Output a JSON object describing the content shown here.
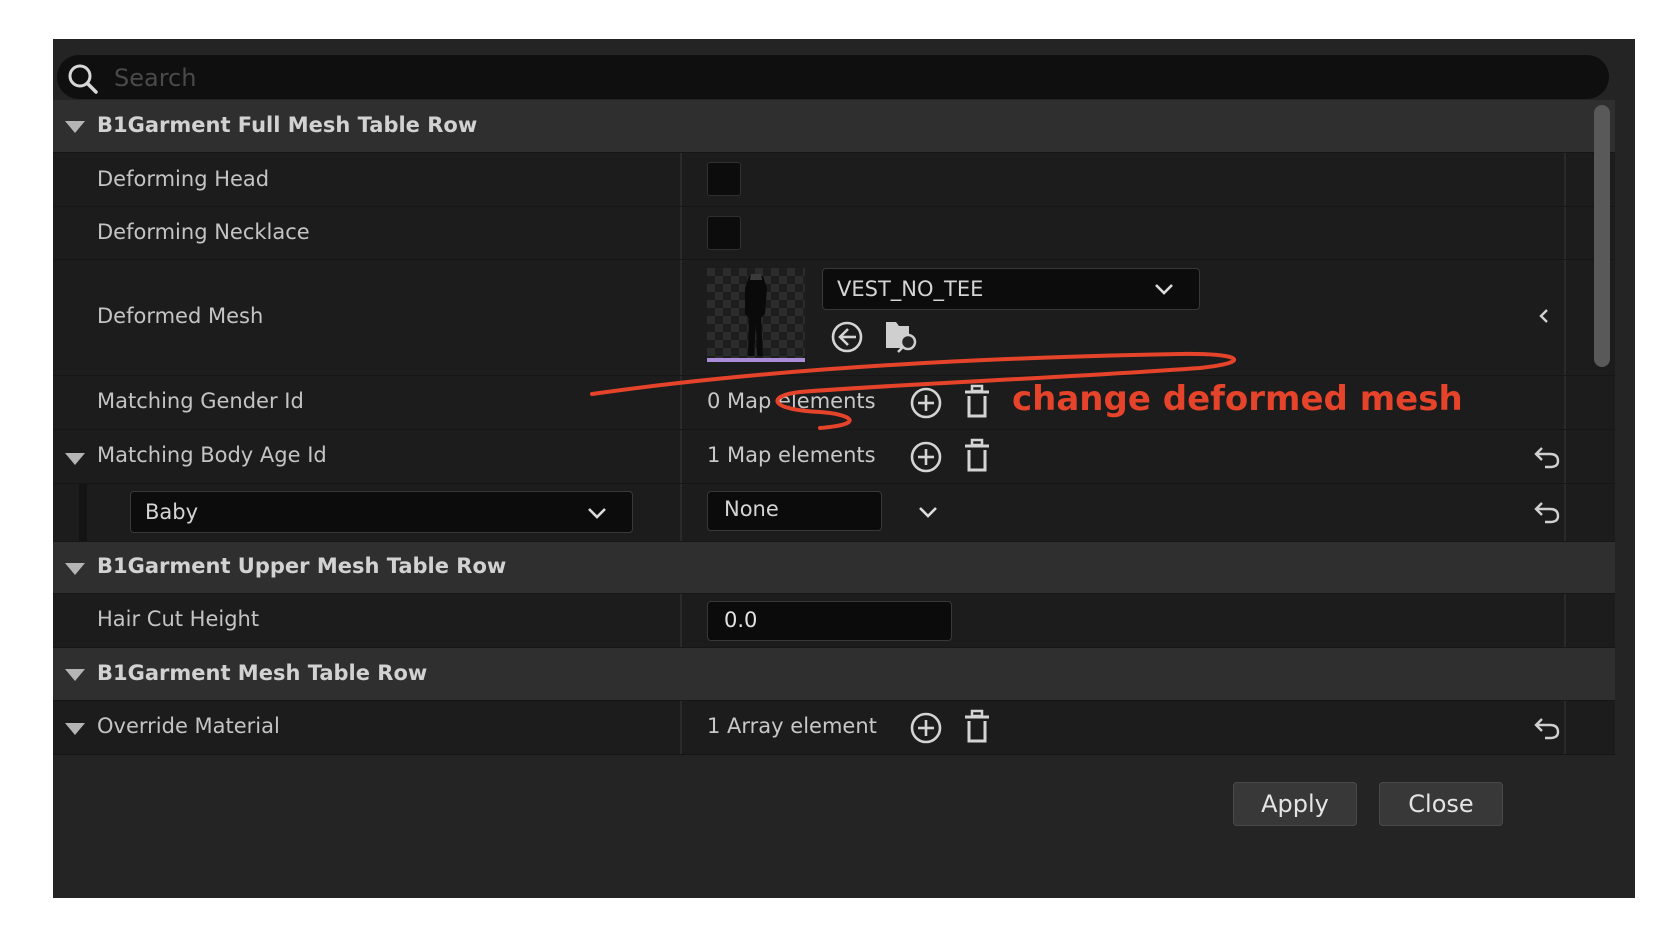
{
  "search": {
    "placeholder": "Search"
  },
  "sections": [
    {
      "title": "B1Garment Full Mesh Table Row"
    },
    {
      "title": "B1Garment Upper Mesh Table Row"
    },
    {
      "title": "B1Garment Mesh Table Row"
    }
  ],
  "properties": {
    "deforming_head": {
      "label": "Deforming Head",
      "checked": false
    },
    "deforming_necklace": {
      "label": "Deforming Necklace",
      "checked": false
    },
    "deformed_mesh": {
      "label": "Deformed Mesh",
      "asset": "VEST_NO_TEE"
    },
    "matching_gender_id": {
      "label": "Matching Gender Id",
      "value": "0 Map elements"
    },
    "matching_body_age_id": {
      "label": "Matching Body Age Id",
      "value": "1 Map elements",
      "entry": {
        "key": "Baby",
        "value": "None"
      }
    },
    "hair_cut_height": {
      "label": "Hair Cut Height",
      "value": "0.0"
    },
    "override_material": {
      "label": "Override Material",
      "value": "1 Array element"
    }
  },
  "buttons": {
    "apply": "Apply",
    "close": "Close"
  },
  "annotation": {
    "text": "change deformed mesh",
    "color": "#e6432b"
  },
  "icons": [
    "search-icon",
    "collapse-triangle-icon",
    "chevron-down-icon",
    "use-selected-asset-icon",
    "browse-asset-icon",
    "add-element-icon",
    "delete-icon",
    "reset-to-default-icon"
  ],
  "colors": {
    "panel": "#242424",
    "section_header": "#2f2f2f",
    "property_row": "#1c1c1c",
    "annotation": "#e6432b"
  }
}
